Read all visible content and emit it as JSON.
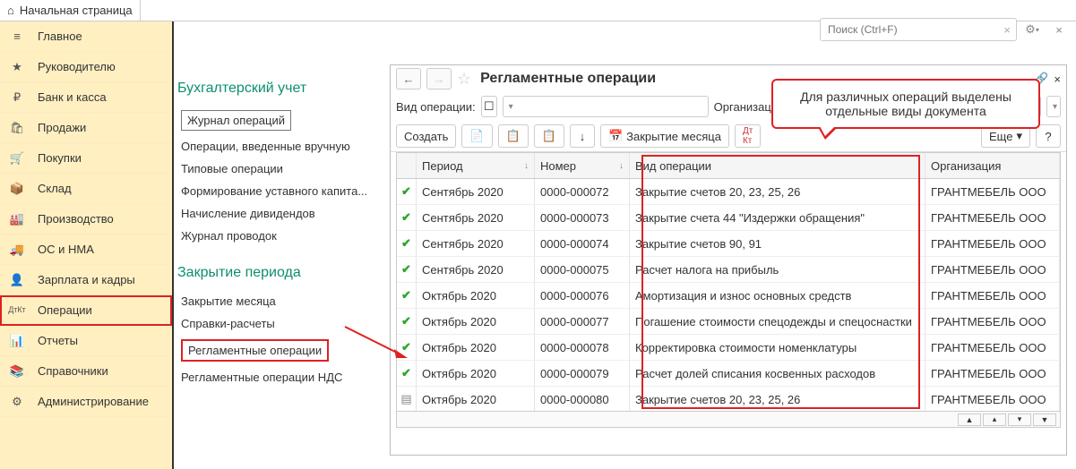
{
  "topbar": {
    "home": "Начальная страница",
    "search_ph": "Поиск (Ctrl+F)"
  },
  "sidebar": {
    "items": [
      {
        "icon": "≡",
        "label": "Главное"
      },
      {
        "icon": "★",
        "label": "Руководителю"
      },
      {
        "icon": "₽",
        "label": "Банк и касса"
      },
      {
        "icon": "🛍",
        "label": "Продажи"
      },
      {
        "icon": "🛒",
        "label": "Покупки"
      },
      {
        "icon": "📦",
        "label": "Склад"
      },
      {
        "icon": "🏭",
        "label": "Производство"
      },
      {
        "icon": "🚚",
        "label": "ОС и НМА"
      },
      {
        "icon": "👤",
        "label": "Зарплата и кадры"
      },
      {
        "icon": "ДтКт",
        "label": "Операции"
      },
      {
        "icon": "📊",
        "label": "Отчеты"
      },
      {
        "icon": "📚",
        "label": "Справочники"
      },
      {
        "icon": "⚙",
        "label": "Администрирование"
      }
    ]
  },
  "mid": {
    "group1_title": "Бухгалтерский учет",
    "group1_items": [
      "Журнал операций",
      "Операции, введенные вручную",
      "Типовые операции",
      "Формирование уставного капита...",
      "Начисление дивидендов",
      "Журнал проводок"
    ],
    "group2_title": "Закрытие периода",
    "group2_items": [
      "Закрытие месяца",
      "Справки-расчеты",
      "Регламентные операции",
      "Регламентные операции НДС"
    ]
  },
  "window": {
    "title": "Регламентные операции",
    "filter_label": "Вид операции:",
    "org_label": "Организация:",
    "create": "Создать",
    "close_month": "Закрытие месяца",
    "more": "Еще",
    "help": "?",
    "columns": [
      "Период",
      "Номер",
      "Вид операции",
      "Организация"
    ]
  },
  "rows": [
    {
      "s": "ok",
      "p": "Сентябрь 2020",
      "n": "0000-000072",
      "t": "Закрытие счетов 20, 23, 25, 26",
      "o": "ГРАНТМЕБЕЛЬ ООО"
    },
    {
      "s": "ok",
      "p": "Сентябрь 2020",
      "n": "0000-000073",
      "t": "Закрытие счета 44 \"Издержки обращения\"",
      "o": "ГРАНТМЕБЕЛЬ ООО"
    },
    {
      "s": "ok",
      "p": "Сентябрь 2020",
      "n": "0000-000074",
      "t": "Закрытие счетов 90, 91",
      "o": "ГРАНТМЕБЕЛЬ ООО"
    },
    {
      "s": "ok",
      "p": "Сентябрь 2020",
      "n": "0000-000075",
      "t": "Расчет налога на прибыль",
      "o": "ГРАНТМЕБЕЛЬ ООО"
    },
    {
      "s": "ok",
      "p": "Октябрь 2020",
      "n": "0000-000076",
      "t": "Амортизация и износ основных средств",
      "o": "ГРАНТМЕБЕЛЬ ООО"
    },
    {
      "s": "ok",
      "p": "Октябрь 2020",
      "n": "0000-000077",
      "t": "Погашение стоимости спецодежды и спецоснастки",
      "o": "ГРАНТМЕБЕЛЬ ООО"
    },
    {
      "s": "ok",
      "p": "Октябрь 2020",
      "n": "0000-000078",
      "t": "Корректировка стоимости номенклатуры",
      "o": "ГРАНТМЕБЕЛЬ ООО"
    },
    {
      "s": "ok",
      "p": "Октябрь 2020",
      "n": "0000-000079",
      "t": "Расчет долей списания косвенных расходов",
      "o": "ГРАНТМЕБЕЛЬ ООО"
    },
    {
      "s": "doc",
      "p": "Октябрь 2020",
      "n": "0000-000080",
      "t": "Закрытие счетов 20, 23, 25, 26",
      "o": "ГРАНТМЕБЕЛЬ ООО"
    }
  ],
  "callout": "Для различных операций выделены отдельные виды документа"
}
